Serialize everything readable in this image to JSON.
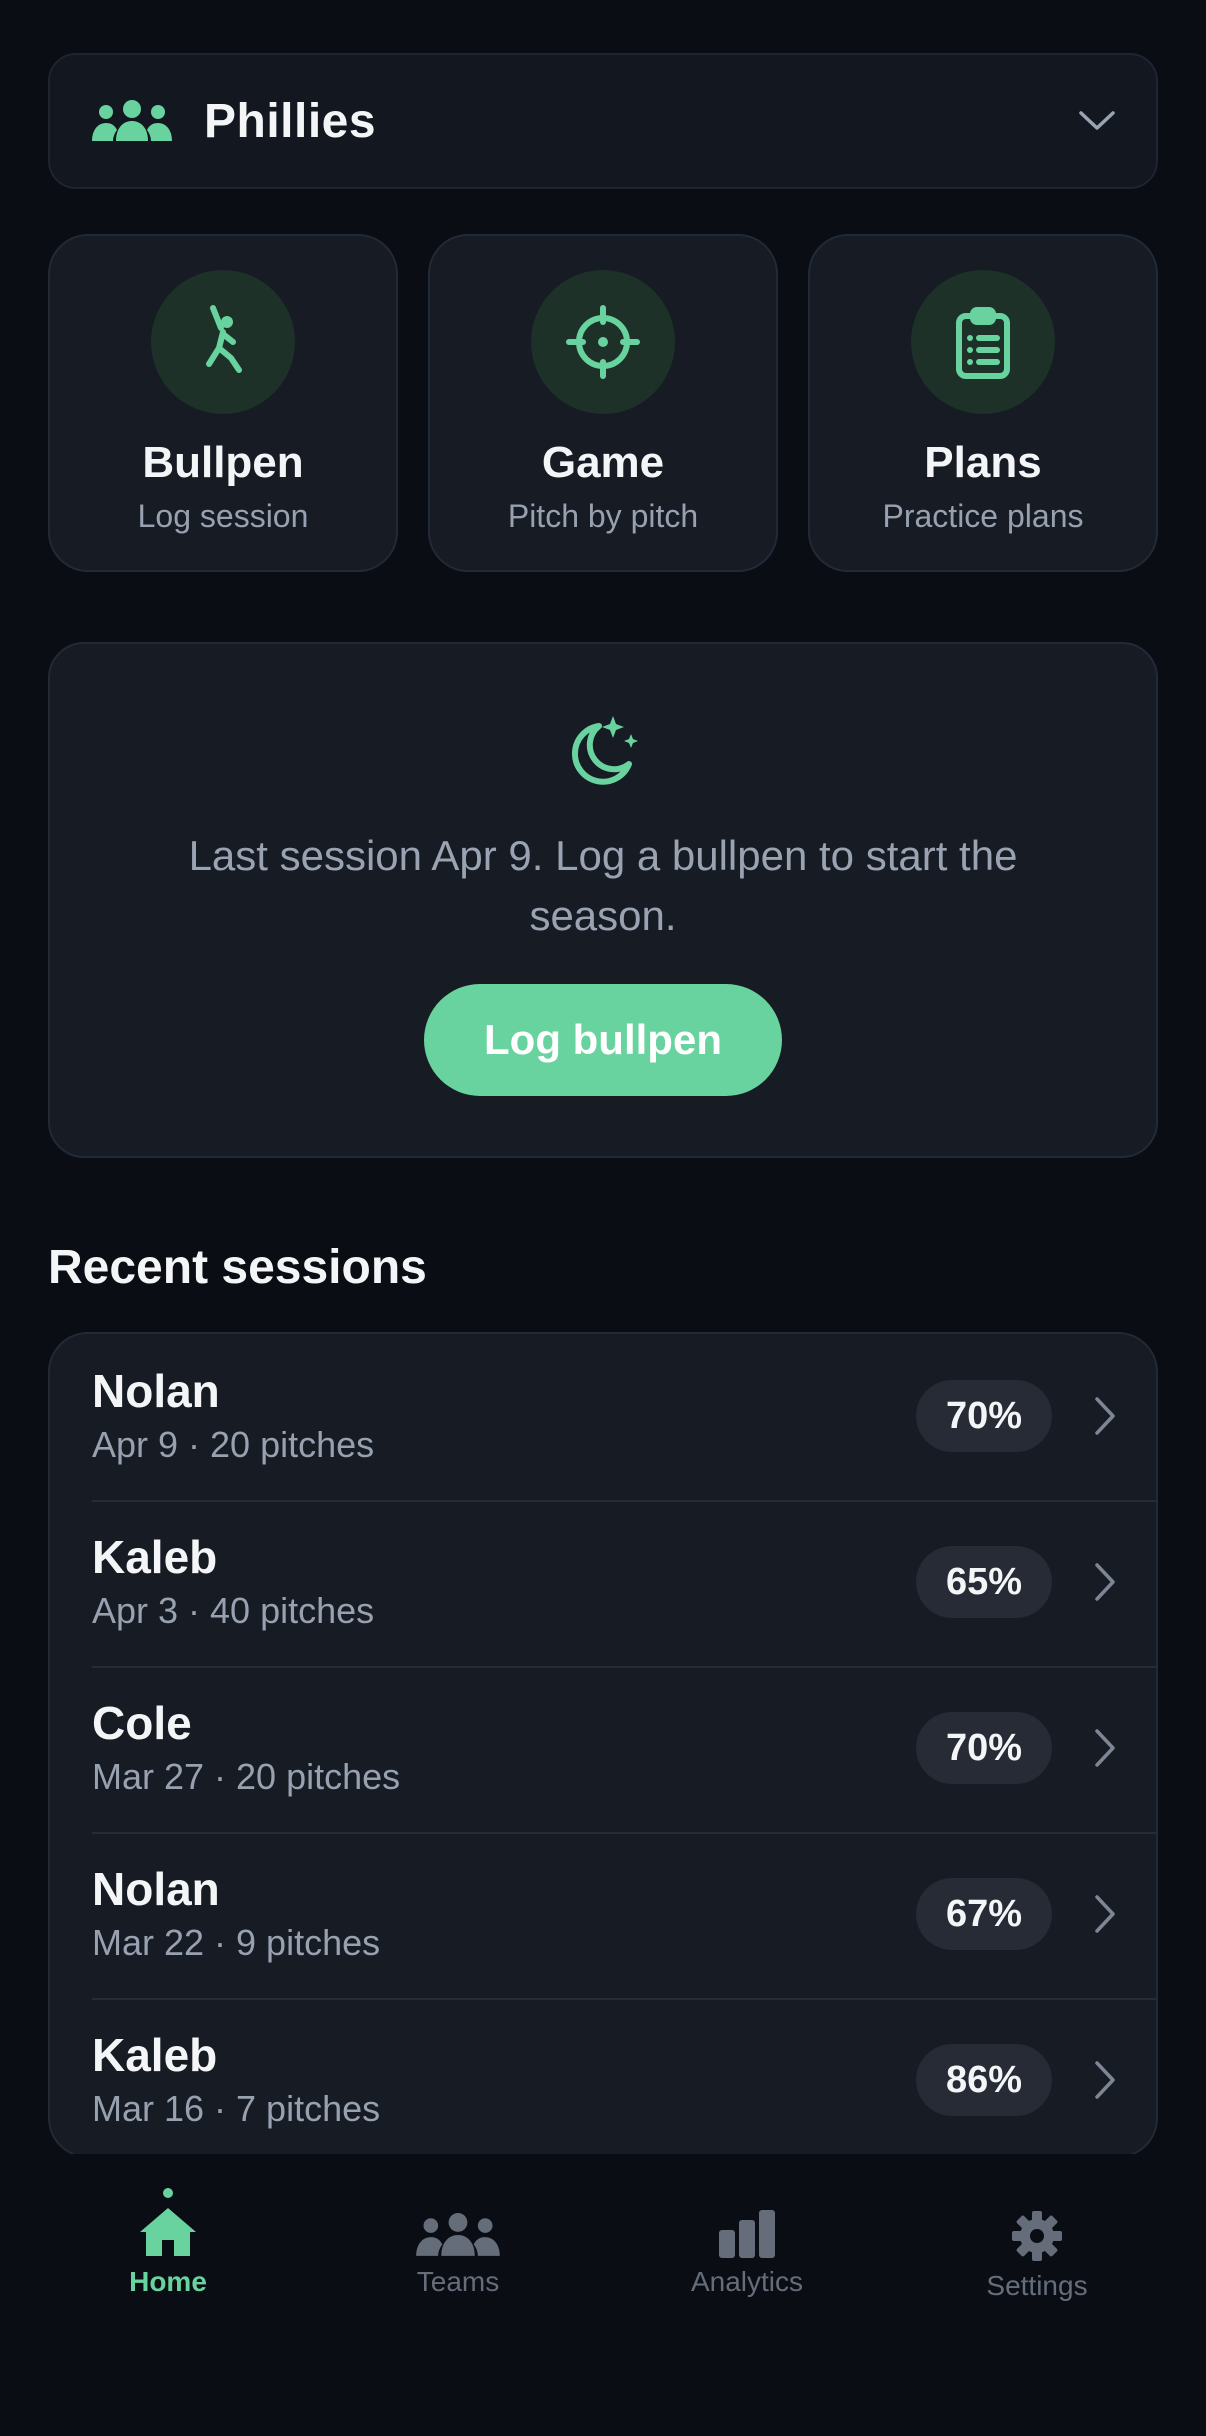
{
  "team_selector": {
    "name": "Phillies",
    "icon": "team-icon"
  },
  "actions": [
    {
      "title": "Bullpen",
      "subtitle": "Log session",
      "icon": "batter-icon"
    },
    {
      "title": "Game",
      "subtitle": "Pitch by pitch",
      "icon": "crosshair-icon"
    },
    {
      "title": "Plans",
      "subtitle": "Practice plans",
      "icon": "clipboard-icon"
    }
  ],
  "empty_state": {
    "icon": "moon-stars-icon",
    "message": "Last session Apr 9. Log a bullpen to start the season.",
    "button_label": "Log bullpen"
  },
  "recent": {
    "title": "Recent sessions",
    "sessions": [
      {
        "name": "Nolan",
        "meta": "Apr 9 · 20 pitches",
        "pct": "70%"
      },
      {
        "name": "Kaleb",
        "meta": "Apr 3 · 40 pitches",
        "pct": "65%"
      },
      {
        "name": "Cole",
        "meta": "Mar 27 · 20 pitches",
        "pct": "70%"
      },
      {
        "name": "Nolan",
        "meta": "Mar 22 · 9 pitches",
        "pct": "67%"
      },
      {
        "name": "Kaleb",
        "meta": "Mar 16 · 7 pitches",
        "pct": "86%"
      }
    ]
  },
  "tabs": [
    {
      "label": "Home",
      "icon": "home-icon",
      "active": true
    },
    {
      "label": "Teams",
      "icon": "teams-icon",
      "active": false
    },
    {
      "label": "Analytics",
      "icon": "analytics-icon",
      "active": false
    },
    {
      "label": "Settings",
      "icon": "settings-icon",
      "active": false
    }
  ],
  "colors": {
    "accent": "#68d39e",
    "background": "#0a0d13",
    "card": "#161b24",
    "muted_text": "#98a1b0"
  }
}
